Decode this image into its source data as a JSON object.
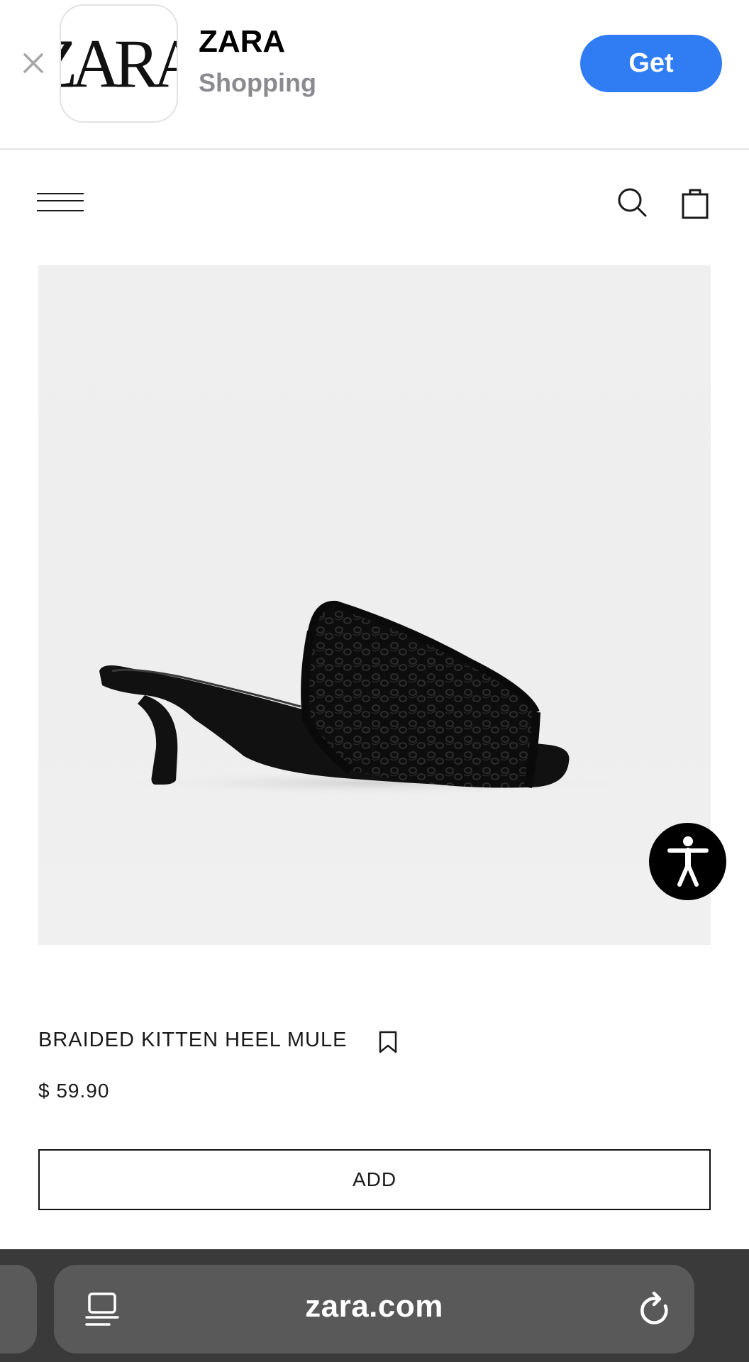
{
  "app_banner": {
    "close_label": "×",
    "icon_logo_text": "ZARA",
    "app_name": "ZARA",
    "app_category": "Shopping",
    "get_label": "Get",
    "get_color": "#2f7cf3"
  },
  "header": {
    "menu_icon": "hamburger-menu-icon",
    "search_icon": "search-icon",
    "bag_icon": "shopping-bag-icon"
  },
  "product": {
    "image_subject": "black-braided-kitten-heel-mule",
    "name": "BRAIDED KITTEN HEEL MULE",
    "bookmark_icon": "bookmark-icon",
    "price": "$ 59.90",
    "add_label": "ADD"
  },
  "accessibility": {
    "icon": "accessibility-person-icon"
  },
  "browser": {
    "url": "zara.com",
    "reader_icon": "reader-mode-icon",
    "reload_icon": "reload-icon"
  }
}
